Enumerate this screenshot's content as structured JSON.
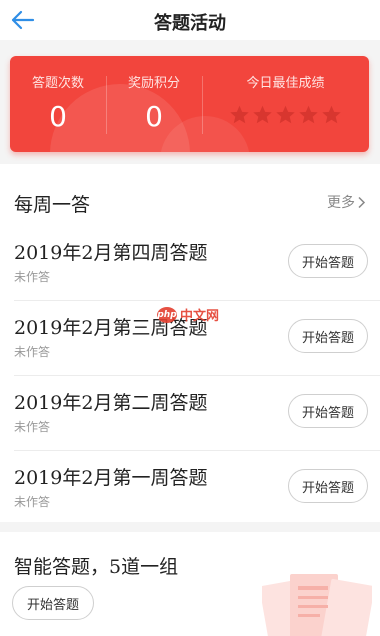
{
  "header": {
    "title": "答题活动"
  },
  "stats": {
    "answer_count_label": "答题次数",
    "answer_count_value": "0",
    "reward_points_label": "奖励积分",
    "reward_points_value": "0",
    "best_score_label": "今日最佳成绩",
    "best_score_stars": 0,
    "best_score_max": 5
  },
  "weekly": {
    "title": "每周一答",
    "more": "更多",
    "items": [
      {
        "name": "2019年2月第四周答题",
        "status": "未作答",
        "button": "开始答题"
      },
      {
        "name": "2019年2月第三周答题",
        "status": "未作答",
        "button": "开始答题"
      },
      {
        "name": "2019年2月第二周答题",
        "status": "未作答",
        "button": "开始答题"
      },
      {
        "name": "2019年2月第一周答题",
        "status": "未作答",
        "button": "开始答题"
      }
    ]
  },
  "smart": {
    "title": "智能答题，5道一组",
    "button": "开始答题"
  },
  "watermark": {
    "badge": "php",
    "text": "中文网"
  },
  "colors": {
    "accent": "#f2453d",
    "back_arrow": "#2f8ee6",
    "star_empty": "#d8362f"
  }
}
